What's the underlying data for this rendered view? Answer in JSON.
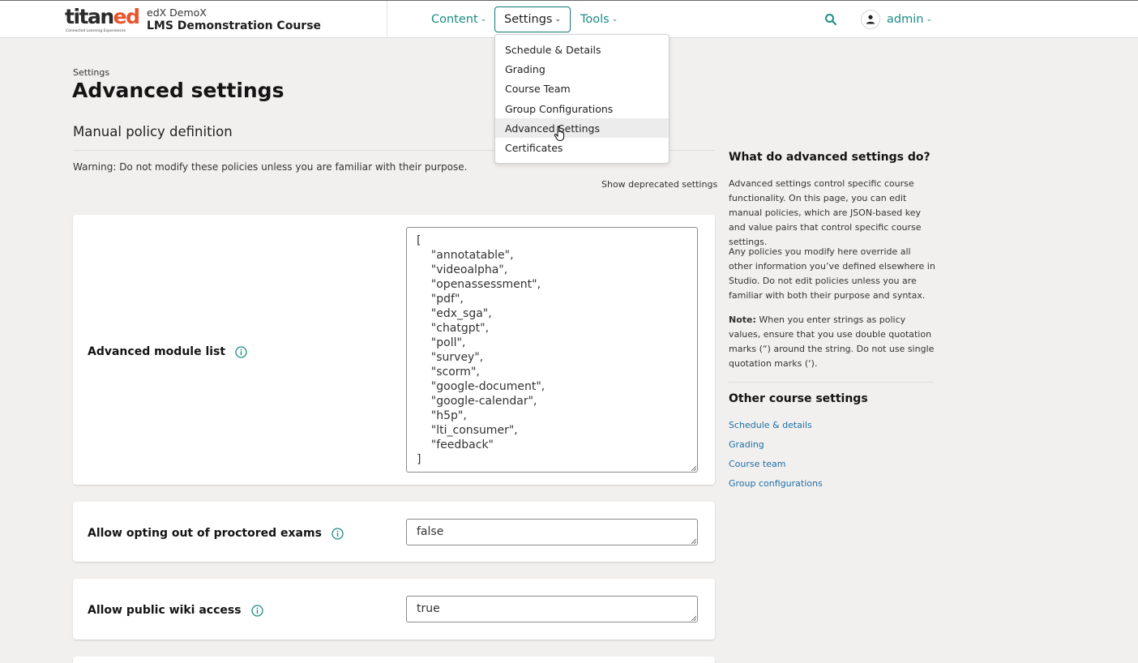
{
  "header": {
    "logo_text_main": "titan",
    "logo_text_accent": "ed",
    "logo_tagline": "Connected Learning Experiences",
    "org": "edX DemoX",
    "course": "LMS Demonstration Course",
    "nav": {
      "content": "Content",
      "settings": "Settings",
      "tools": "Tools"
    },
    "user": "admin",
    "accent_color": "#1a8c83"
  },
  "settings_menu": {
    "items": [
      "Schedule & Details",
      "Grading",
      "Course Team",
      "Group Configurations",
      "Advanced Settings",
      "Certificates"
    ],
    "hovered": "Advanced Settings"
  },
  "page": {
    "breadcrumb": "Settings",
    "title": "Advanced settings",
    "section_title": "Manual policy definition",
    "warning": "Warning: Do not modify these policies unless you are familiar with their purpose.",
    "show_deprecated": "Show deprecated settings"
  },
  "settings": [
    {
      "label": "Advanced module list",
      "value_lines": [
        "[",
        "    \"annotatable\",",
        "    \"videoalpha\",",
        "    \"openassessment\",",
        "    \"pdf\",",
        "    \"edx_sga\",",
        "    \"chatgpt\",",
        "    \"poll\",",
        "    \"survey\",",
        "    \"scorm\",",
        "    \"google-document\",",
        "    \"google-calendar\",",
        "    \"h5p\",",
        "    \"lti_consumer\",",
        "    \"feedback\"",
        "]"
      ]
    },
    {
      "label": "Allow opting out of proctored exams",
      "value": "false"
    },
    {
      "label": "Allow public wiki access",
      "value": "true"
    }
  ],
  "sidebar": {
    "heading": "What do advanced settings do?",
    "para1": "Advanced settings control specific course functionality. On this page, you can edit manual policies, which are JSON-based key and value pairs that control specific course settings.",
    "para2": "Any policies you modify here override all other information you’ve defined elsewhere in Studio. Do not edit policies unless you are familiar with both their purpose and syntax.",
    "note_label": "Note:",
    "note_text": " When you enter strings as policy values, ensure that you use double quotation marks (“) around the string. Do not use single quotation marks (‘).",
    "other_heading": "Other course settings",
    "links": [
      "Schedule & details",
      "Grading",
      "Course team",
      "Group configurations"
    ]
  }
}
